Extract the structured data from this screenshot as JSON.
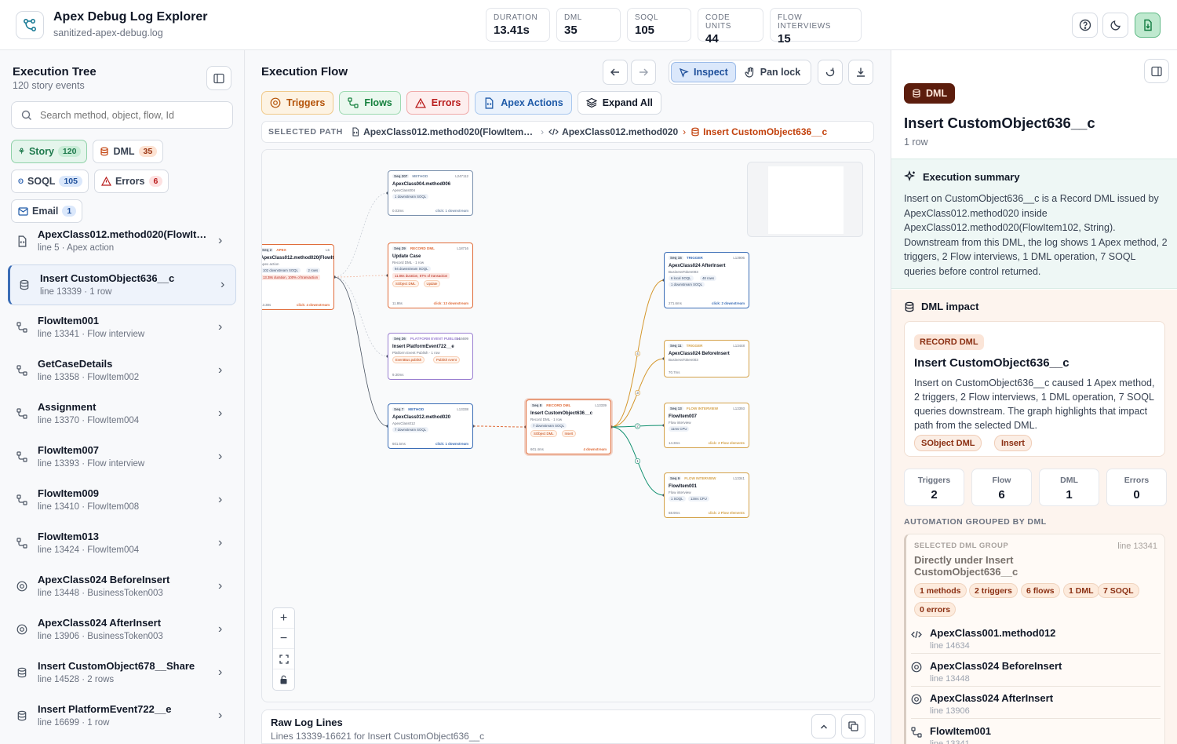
{
  "app": {
    "title": "Apex Debug Log Explorer",
    "file": "sanitized-apex-debug.log"
  },
  "metrics": [
    {
      "label": "DURATION",
      "value": "13.41s"
    },
    {
      "label": "DML",
      "value": "35"
    },
    {
      "label": "SOQL",
      "value": "105"
    },
    {
      "label": "CODE UNITS",
      "value": "44"
    },
    {
      "label": "FLOW INTERVIEWS",
      "value": "15"
    }
  ],
  "sidebar": {
    "title": "Execution Tree",
    "subtitle": "120 story events",
    "search_placeholder": "Search method, object, flow, Id",
    "filters": [
      {
        "label": "Story",
        "count": "120"
      },
      {
        "label": "DML",
        "count": "35"
      },
      {
        "label": "SOQL",
        "count": "105"
      },
      {
        "label": "Errors",
        "count": "6"
      },
      {
        "label": "Email",
        "count": "1"
      }
    ],
    "items": [
      {
        "label": "ApexClass012.method020(FlowItem102, String)",
        "sub": "line 5 · Apex action",
        "icon": "apex-action-icon"
      },
      {
        "label": "Insert CustomObject636__c",
        "sub": "line 13339 · 1 row",
        "icon": "database-icon"
      },
      {
        "label": "FlowItem001",
        "sub": "line 13341 · Flow interview",
        "icon": "flow-icon"
      },
      {
        "label": "GetCaseDetails",
        "sub": "line 13358 · FlowItem002",
        "icon": "flow-icon"
      },
      {
        "label": "Assignment",
        "sub": "line 13370 · FlowItem004",
        "icon": "flow-icon"
      },
      {
        "label": "FlowItem007",
        "sub": "line 13393 · Flow interview",
        "icon": "flow-icon"
      },
      {
        "label": "FlowItem009",
        "sub": "line 13410 · FlowItem008",
        "icon": "flow-icon"
      },
      {
        "label": "FlowItem013",
        "sub": "line 13424 · FlowItem004",
        "icon": "flow-icon"
      },
      {
        "label": "ApexClass024 BeforeInsert",
        "sub": "line 13448 · BusinessToken003",
        "icon": "trigger-icon"
      },
      {
        "label": "ApexClass024 AfterInsert",
        "sub": "line 13906 · BusinessToken003",
        "icon": "trigger-icon"
      },
      {
        "label": "Insert CustomObject678__Share",
        "sub": "line 14528 · 2 rows",
        "icon": "database-icon"
      },
      {
        "label": "Insert PlatformEvent722__e",
        "sub": "line 16699 · 1 row",
        "icon": "database-icon"
      }
    ]
  },
  "flow": {
    "title": "Execution Flow",
    "inspect_label": "Inspect",
    "panlock_label": "Pan lock",
    "chips": [
      {
        "label": "Triggers",
        "icon": "trigger-icon",
        "color": "#b45309",
        "bg": "#fdf3e3",
        "border": "#f0c98a"
      },
      {
        "label": "Flows",
        "icon": "flow-icon",
        "color": "#15803d",
        "bg": "#ebf8ef",
        "border": "#9cd9b0"
      },
      {
        "label": "Errors",
        "icon": "warning-icon",
        "color": "#b91c1c",
        "bg": "#fdeeee",
        "border": "#f0a9a9"
      },
      {
        "label": "Apex Actions",
        "icon": "apex-action-icon",
        "color": "#1e5aa8",
        "bg": "#eaf2fc",
        "border": "#a9c8ee"
      },
      {
        "label": "Expand All",
        "icon": "layers-icon",
        "color": "#111827",
        "bg": "#ffffff",
        "border": "#d6dbe3"
      }
    ],
    "breadcrumb": {
      "label": "SELECTED PATH",
      "items": [
        "ApexClass012.method020(FlowItem102, String)",
        "ApexClass012.method020",
        "Insert CustomObject636__c"
      ]
    }
  },
  "graph": {
    "nodes": [
      {
        "id": "apex",
        "seq": "Seq 2",
        "kind": "APEX",
        "line": "L5",
        "title": "ApexClass012.method020(FlowItem102, String)",
        "sub": "Apex action",
        "badges": [
          "102 downstream SOQL",
          "2 rows"
        ],
        "alert": "13.38s duration, 100% of transaction",
        "foot_l": "13.38s",
        "foot_r": "click: 4 downstream",
        "color": "#e06c3a"
      },
      {
        "id": "m006",
        "seq": "Seq 207",
        "kind": "METHOD",
        "line": "L247112",
        "title": "ApexClass004.method006",
        "sub": "ApexClass004",
        "badges": [
          "1 downstream SOQL"
        ],
        "foot_l": "0.03ms",
        "foot_r": "click: 1 downstream",
        "color": "#7a90ad"
      },
      {
        "id": "uc",
        "seq": "Seq 29",
        "kind": "RECORD DML",
        "line": "L18716",
        "title": "Update Case",
        "sub": "Record DML · 1 row",
        "badges": [
          "94 downstream SOQL"
        ],
        "alert": "11.86s duration, 87% of transaction",
        "tags": [
          "SObject DML",
          "Update"
        ],
        "foot_l": "11.86s",
        "foot_r": "click: 13 downstream",
        "color": "#e06c3a"
      },
      {
        "id": "pe",
        "seq": "Seq 26",
        "kind": "PLATFORM EVENT PUBLISH",
        "line": "L16699",
        "title": "Insert PlatformEvent722__e",
        "sub": "Platform Event Publish · 1 row",
        "tags": [
          "EventBus.publish",
          "Publish event"
        ],
        "foot_l": "9.30ms",
        "foot_r": "",
        "color": "#9a7fd1"
      },
      {
        "id": "m020",
        "seq": "Seq 7",
        "kind": "METHOD",
        "line": "L13338",
        "title": "ApexClass012.method020",
        "sub": "ApexClass012",
        "badges": [
          "7 downstream SOQL"
        ],
        "foot_l": "601.5ms",
        "foot_r": "click: 1 downstream",
        "color": "#3b6db6"
      },
      {
        "id": "ins",
        "seq": "Seq 8",
        "kind": "RECORD DML",
        "line": "L13339",
        "title": "Insert CustomObject636__c",
        "sub": "Record DML · 1 row",
        "badges": [
          "7 downstream SOQL"
        ],
        "tags": [
          "SObject DML",
          "Insert"
        ],
        "foot_l": "601.4ms",
        "foot_r": "4 downstream",
        "color": "#e06c3a"
      },
      {
        "id": "ai",
        "seq": "Seq 15",
        "kind": "TRIGGER",
        "line": "L13906",
        "title": "ApexClass024 AfterInsert",
        "sub": "BusinessToken003",
        "badges": [
          "6 local SOQL",
          "48 rows",
          "1 downstream SOQL"
        ],
        "foot_l": "271.6ms",
        "foot_r": "click: 2 downstream",
        "color": "#3b6db6"
      },
      {
        "id": "bi",
        "seq": "Seq 11",
        "kind": "TRIGGER",
        "line": "L13448",
        "title": "ApexClass024 BeforeInsert",
        "sub": "BusinessToken003",
        "foot_l": "70.7ms",
        "foot_r": "",
        "color": "#d4a24a"
      },
      {
        "id": "f7",
        "seq": "Seq 13",
        "kind": "FLOW INTERVIEW",
        "line": "L13393",
        "title": "FlowItem007",
        "sub": "Flow interview",
        "badges": [
          "11ms CPU"
        ],
        "foot_l": "14.3ms",
        "foot_r": "click: 2 Flow elements",
        "color": "#d4a24a"
      },
      {
        "id": "f1",
        "seq": "Seq 9",
        "kind": "FLOW INTERVIEW",
        "line": "L13341",
        "title": "FlowItem001",
        "sub": "Flow interview",
        "badges": [
          "1 SOQL",
          "13ms CPU"
        ],
        "foot_l": "68.9ms",
        "foot_r": "click: 2 Flow elements",
        "color": "#d4a24a"
      }
    ],
    "edge_labels": [
      "4",
      "3",
      "2",
      "1"
    ]
  },
  "rawlog": {
    "title": "Raw Log Lines",
    "subtitle": "Lines 13339-16621 for Insert CustomObject636__c"
  },
  "detail": {
    "pill": "DML",
    "title": "Insert CustomObject636__c",
    "sub": "1 row",
    "summary_title": "Execution summary",
    "summary": "Insert on CustomObject636__c is a Record DML issued by ApexClass012.method020 inside ApexClass012.method020(FlowItem102, String). Downstream from this DML, the log shows 1 Apex method, 2 triggers, 2 Flow interviews, 1 DML operation, 7 SOQL queries before control returned.",
    "impact_title": "DML impact",
    "card": {
      "tag": "RECORD DML",
      "title": "Insert CustomObject636__c",
      "text": "Insert on CustomObject636__c caused 1 Apex method, 2 triggers, 2 Flow interviews, 1 DML operation, 7 SOQL queries downstream. The graph highlights that impact path from the selected DML.",
      "badges": [
        "SObject DML",
        "Insert"
      ]
    },
    "stats": [
      {
        "label": "Triggers",
        "value": "2"
      },
      {
        "label": "Flow",
        "value": "6"
      },
      {
        "label": "DML",
        "value": "1"
      },
      {
        "label": "Errors",
        "value": "0"
      }
    ],
    "group_label": "AUTOMATION GROUPED BY DML",
    "group": {
      "label": "SELECTED DML GROUP",
      "line": "line 13341",
      "title": "Directly under Insert CustomObject636__c",
      "badges": [
        "1 methods",
        "2 triggers",
        "6 flows",
        "1 DML",
        "7 SOQL",
        "0 errors"
      ],
      "items": [
        {
          "name": "ApexClass001.method012",
          "line": "line 14634",
          "icon": "code-icon"
        },
        {
          "name": "ApexClass024 BeforeInsert",
          "line": "line 13448",
          "icon": "trigger-icon"
        },
        {
          "name": "ApexClass024 AfterInsert",
          "line": "line 13906",
          "icon": "trigger-icon"
        },
        {
          "name": "FlowItem001",
          "line": "line 13341",
          "icon": "flow-icon"
        }
      ]
    }
  }
}
